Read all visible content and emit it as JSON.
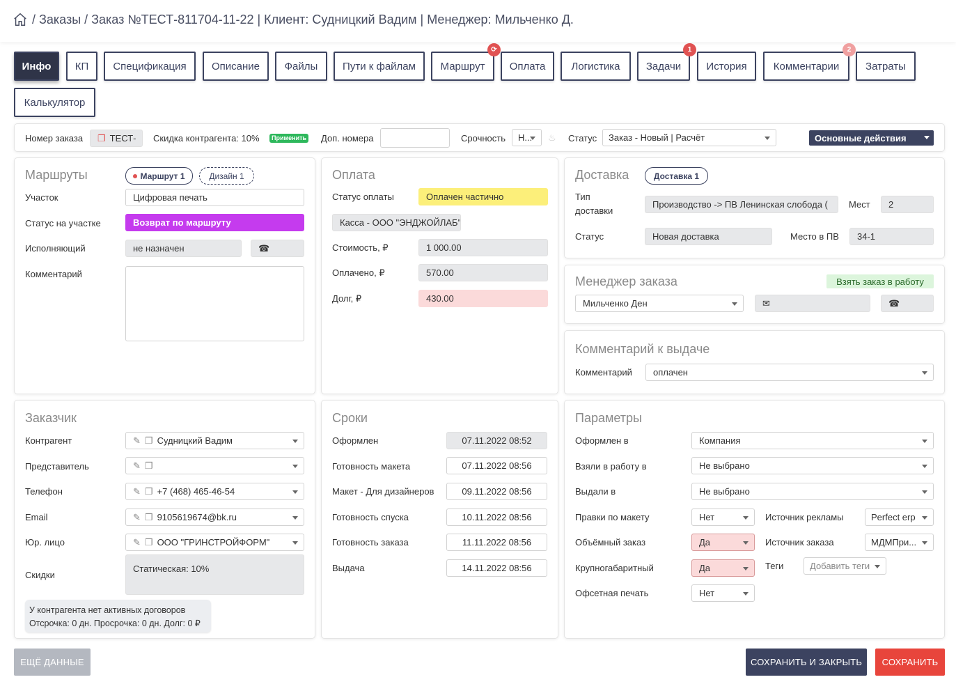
{
  "breadcrumb": "/ Заказы / Заказ №ТЕСТ-811704-11-22 | Клиент: Судницкий Вадим | Менеджер: Мильченко Д.",
  "tabs": [
    "Инфо",
    "КП",
    "Спецификация",
    "Описание",
    "Файлы",
    "Пути к файлам",
    "Маршрут",
    "Оплата",
    "Логистика",
    "Задачи",
    "История",
    "Комментарии",
    "Затраты",
    "Калькулятор"
  ],
  "badges": {
    "route": "⟳",
    "tasks": "1",
    "comments": "2"
  },
  "topbar": {
    "order_no_label": "Номер заказа",
    "order_no": "ТЕСТ-",
    "discount": "Скидка контрагента: 10%",
    "apply": "Применить",
    "extra_label": "Доп. номера",
    "extra_value": "",
    "urgency_label": "Срочность",
    "urgency": "Н...",
    "status_label": "Статус",
    "status": "Заказ - Новый | Расчёт",
    "actions": "Основные действия"
  },
  "routes": {
    "title": "Маршруты",
    "pill1": "Маршрут 1",
    "pill2": "Дизайн 1",
    "section_label": "Участок",
    "section": "Цифровая печать",
    "status_label": "Статус на участке",
    "status": "Возврат по маршруту",
    "executor_label": "Исполняющий",
    "executor": "не назначен",
    "comment_label": "Комментарий",
    "comment": ""
  },
  "payment": {
    "title": "Оплата",
    "status_label": "Статус оплаты",
    "status": "Оплачен частично",
    "cash": "Касса - ООО \"ЭНДЖОЙЛАБ\"",
    "cost_label": "Стоимость, ₽",
    "cost": "1 000.00",
    "paid_label": "Оплачено, ₽",
    "paid": "570.00",
    "debt_label": "Долг, ₽",
    "debt": "430.00"
  },
  "delivery": {
    "title": "Доставка",
    "pill": "Доставка 1",
    "type_label1": "Тип",
    "type_label2": "доставки",
    "type": "Производство -> ПВ Ленинская слобода (",
    "places_label": "Мест",
    "places": "2",
    "status_label": "Статус",
    "status": "Новая доставка",
    "pv_label": "Место в ПВ",
    "pv": "34-1"
  },
  "manager": {
    "title": "Менеджер заказа",
    "take": "Взять заказ в работу",
    "name": "Мильченко Ден"
  },
  "issue": {
    "title": "Комментарий к выдаче",
    "label": "Комментарий",
    "value": "оплачен"
  },
  "customer": {
    "title": "Заказчик",
    "contractor_label": "Контрагент",
    "contractor": "Судницкий Вадим",
    "rep_label": "Представитель",
    "rep": "",
    "phone_label": "Телефон",
    "phone": "+7 (468) 465-46-54",
    "email_label": "Email",
    "email": "9105619674@bk.ru",
    "legal_label": "Юр. лицо",
    "legal": "ООО \"ГРИНСТРОЙФОРМ\"",
    "discount_label": "Скидки",
    "discount": "Статическая: 10%",
    "note1": "У контрагента нет активных договоров",
    "note2": "Отсрочка: 0 дн. Просрочка: 0 дн. Долг: 0 ₽"
  },
  "dates": {
    "title": "Сроки",
    "rows": [
      [
        "Оформлен",
        "07.11.2022 08:52"
      ],
      [
        "Готовность макета",
        "07.11.2022 08:56"
      ],
      [
        "Макет - Для дизайнеров",
        "09.11.2022 08:56"
      ],
      [
        "Готовность спуска",
        "10.11.2022 08:56"
      ],
      [
        "Готовность заказа",
        "11.11.2022 08:56"
      ],
      [
        "Выдача",
        "14.11.2022 08:56"
      ]
    ]
  },
  "params": {
    "title": "Параметры",
    "made_label": "Оформлен в",
    "made": "Компания",
    "taken_label": "Взяли в работу в",
    "taken": "Не выбрано",
    "issued_label": "Выдали в",
    "issued": "Не выбрано",
    "edits_label": "Правки по макету",
    "edits": "Нет",
    "ad_label": "Источник рекламы",
    "ad": "Perfect erp",
    "volume_label": "Объёмный заказ",
    "volume": "Да",
    "src_label": "Источник заказа",
    "src": "МДМПри...",
    "large_label": "Крупногабаритный",
    "large": "Да",
    "tags_label": "Теги",
    "tags": "Добавить теги",
    "offset_label": "Офсетная печать",
    "offset": "Нет"
  },
  "footer": {
    "more": "ЕЩЁ ДАННЫЕ",
    "save_close": "СОХРАНИТЬ И ЗАКРЫТЬ",
    "save": "СОХРАНИТЬ"
  }
}
